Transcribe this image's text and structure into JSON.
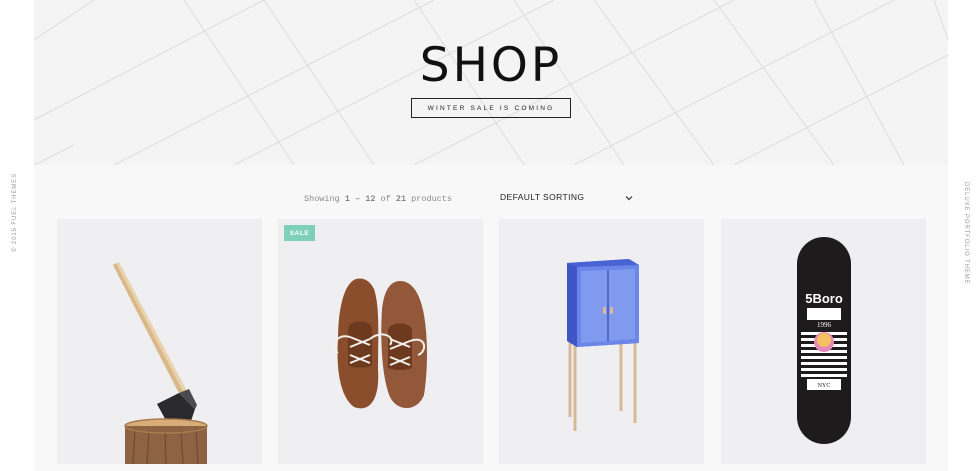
{
  "side": {
    "left_text": "© 2015 FUEL THEMES",
    "right_text": "DELUXE PORTFOLIO THEME"
  },
  "hero": {
    "title": "SHOP",
    "badge": "WINTER SALE IS COMING"
  },
  "toolbar": {
    "showing_prefix": "Showing",
    "range": "1 – 12",
    "of_label": "of",
    "total": "21",
    "products_label": "products",
    "sorting_selected": "DEFAULT SORTING"
  },
  "products": [
    {
      "name": "Axe",
      "image": "axe-in-stump"
    },
    {
      "name": "Brown leather shoes",
      "image": "leather-shoes",
      "badge": "SALE"
    },
    {
      "name": "Blue cabinet",
      "image": "blue-cabinet"
    },
    {
      "name": "Skateboard",
      "image": "skateboard-deck"
    }
  ],
  "skateboard": {
    "brand": "5Boro",
    "year": "1996",
    "city": "NYC"
  },
  "colors": {
    "sale_badge": "#7fd0b8",
    "hero_bg": "#f4f4f5",
    "cabinet_blue": "#4a5fd0"
  }
}
